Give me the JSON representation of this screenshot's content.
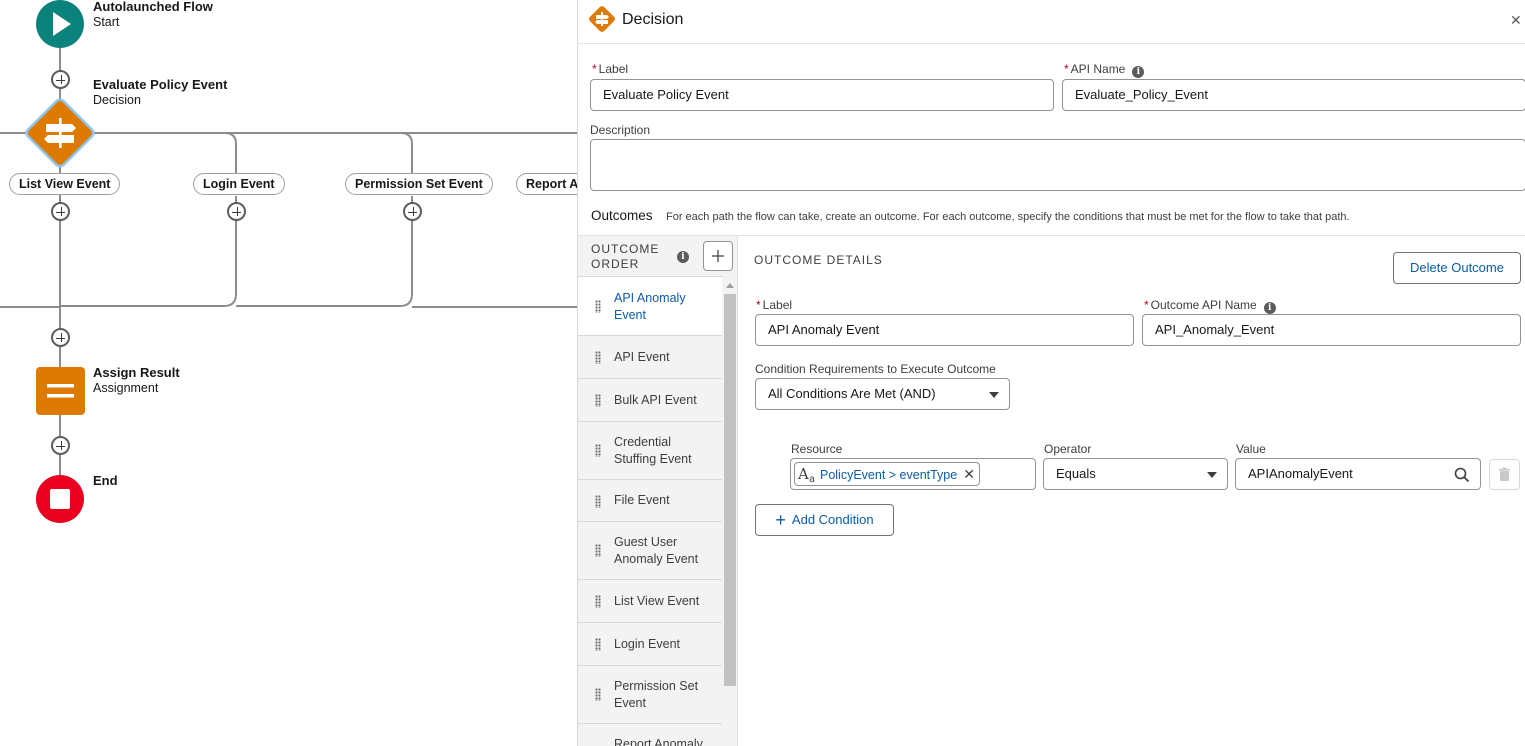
{
  "canvas": {
    "start": {
      "title": "Autolaunched Flow",
      "subtitle": "Start"
    },
    "decision": {
      "title": "Evaluate Policy Event",
      "subtitle": "Decision"
    },
    "branches": [
      "List View Event",
      "Login Event",
      "Permission Set Event",
      "Report An"
    ],
    "assignment": {
      "title": "Assign Result",
      "subtitle": "Assignment"
    },
    "end": {
      "title": "End"
    }
  },
  "panel": {
    "title": "Decision",
    "close_glyph": "✕",
    "label_field": {
      "label": "Label",
      "value": "Evaluate Policy Event"
    },
    "api_name_field": {
      "label": "API Name",
      "value": "Evaluate_Policy_Event"
    },
    "description_field": {
      "label": "Description",
      "value": ""
    },
    "outcomes": {
      "heading": "Outcomes",
      "help": "For each path the flow can take, create an outcome. For each outcome, specify the conditions that must be met for the flow to take that path."
    },
    "outcome_order": {
      "heading": "OUTCOME ORDER",
      "items": [
        "API Anomaly Event",
        "API Event",
        "Bulk API Event",
        "Credential Stuffing Event",
        "File Event",
        "Guest User Anomaly Event",
        "List View Event",
        "Login Event",
        "Permission Set Event",
        "Report Anomaly"
      ]
    },
    "outcome_details": {
      "heading": "OUTCOME DETAILS",
      "delete_label": "Delete Outcome",
      "label_field": {
        "label": "Label",
        "value": "API Anomaly Event"
      },
      "api_name_field": {
        "label": "Outcome API Name",
        "value": "API_Anomaly_Event"
      },
      "condition_req": {
        "label": "Condition Requirements to Execute Outcome",
        "value": "All Conditions Are Met (AND)"
      },
      "condition": {
        "resource_label": "Resource",
        "resource_pill": "PolicyEvent > eventType",
        "operator_label": "Operator",
        "operator_value": "Equals",
        "value_label": "Value",
        "value_value": "APIAnomalyEvent"
      },
      "add_condition_label": "Add Condition"
    }
  },
  "colors": {
    "accent": "#0b5cab",
    "start_node": "#0b827c",
    "decision_node": "#dd7a01",
    "assignment_node": "#dd7a01",
    "end_node": "#ea001e",
    "required": "#ba0517"
  }
}
